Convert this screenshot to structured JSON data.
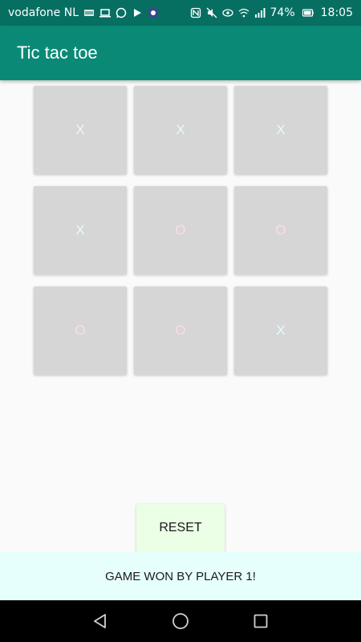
{
  "status_bar": {
    "carrier": "vodafone NL",
    "battery": "74%",
    "time": "18:05",
    "left_icons": [
      "notification-icon",
      "laptop-icon",
      "whatsapp-icon",
      "play-store-icon",
      "app-icon"
    ],
    "right_icons": [
      "nfc-icon",
      "mute-icon",
      "eye-icon",
      "wifi-icon",
      "signal-icon",
      "battery-icon"
    ]
  },
  "app_bar": {
    "title": "Tic tac toe",
    "color": "#0a8a76"
  },
  "board": {
    "cells": [
      "X",
      "X",
      "X",
      "X",
      "O",
      "O",
      "O",
      "O",
      "X"
    ],
    "x_color": "#e6fbff",
    "o_color": "#fbdde3"
  },
  "controls": {
    "reset_label": "RESET"
  },
  "result": {
    "message": "GAME WON BY PLAYER 1!"
  },
  "nav_bar": {
    "icons": [
      "back-icon",
      "home-icon",
      "recents-icon"
    ]
  }
}
